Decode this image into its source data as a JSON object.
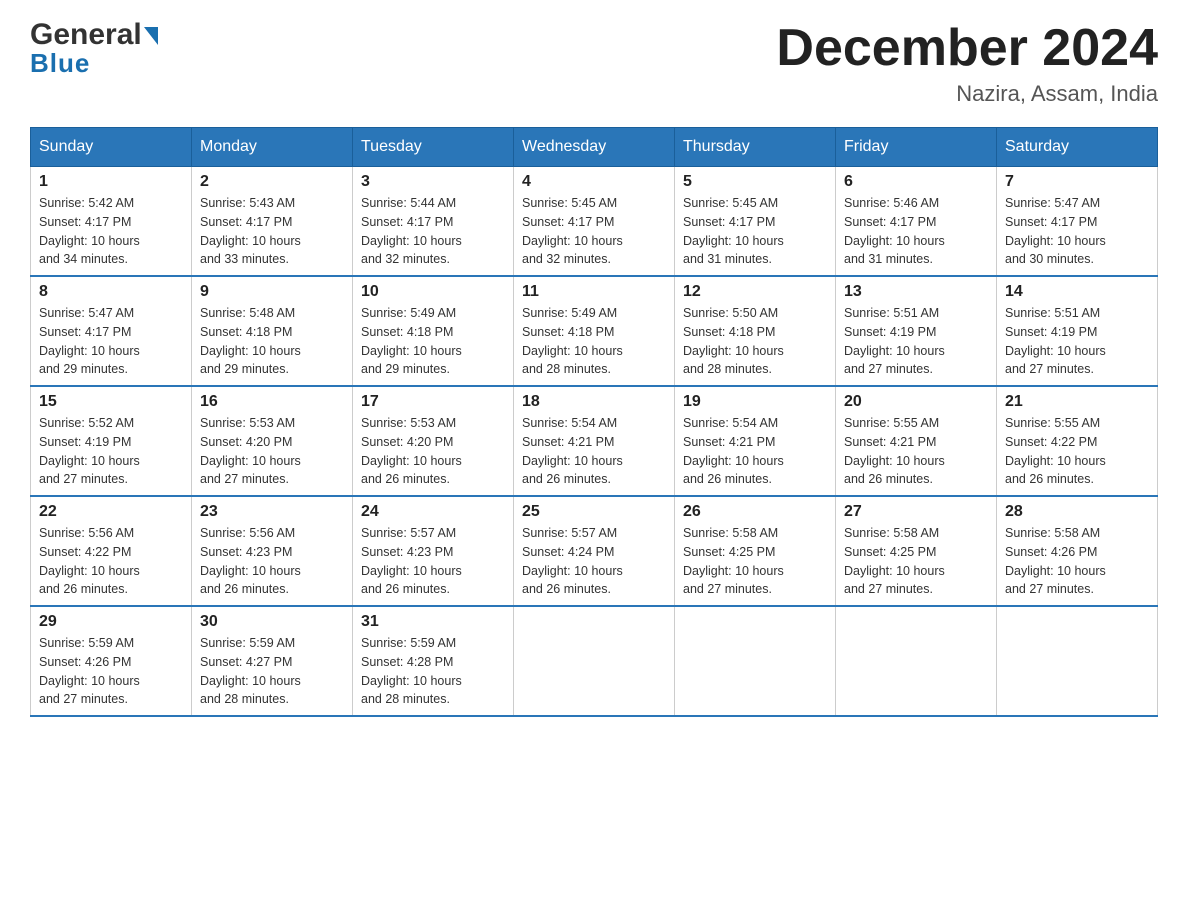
{
  "header": {
    "logo_general": "General",
    "logo_blue": "Blue",
    "title": "December 2024",
    "subtitle": "Nazira, Assam, India"
  },
  "days_of_week": [
    "Sunday",
    "Monday",
    "Tuesday",
    "Wednesday",
    "Thursday",
    "Friday",
    "Saturday"
  ],
  "weeks": [
    [
      {
        "day": "1",
        "sunrise": "5:42 AM",
        "sunset": "4:17 PM",
        "daylight": "10 hours and 34 minutes."
      },
      {
        "day": "2",
        "sunrise": "5:43 AM",
        "sunset": "4:17 PM",
        "daylight": "10 hours and 33 minutes."
      },
      {
        "day": "3",
        "sunrise": "5:44 AM",
        "sunset": "4:17 PM",
        "daylight": "10 hours and 32 minutes."
      },
      {
        "day": "4",
        "sunrise": "5:45 AM",
        "sunset": "4:17 PM",
        "daylight": "10 hours and 32 minutes."
      },
      {
        "day": "5",
        "sunrise": "5:45 AM",
        "sunset": "4:17 PM",
        "daylight": "10 hours and 31 minutes."
      },
      {
        "day": "6",
        "sunrise": "5:46 AM",
        "sunset": "4:17 PM",
        "daylight": "10 hours and 31 minutes."
      },
      {
        "day": "7",
        "sunrise": "5:47 AM",
        "sunset": "4:17 PM",
        "daylight": "10 hours and 30 minutes."
      }
    ],
    [
      {
        "day": "8",
        "sunrise": "5:47 AM",
        "sunset": "4:17 PM",
        "daylight": "10 hours and 29 minutes."
      },
      {
        "day": "9",
        "sunrise": "5:48 AM",
        "sunset": "4:18 PM",
        "daylight": "10 hours and 29 minutes."
      },
      {
        "day": "10",
        "sunrise": "5:49 AM",
        "sunset": "4:18 PM",
        "daylight": "10 hours and 29 minutes."
      },
      {
        "day": "11",
        "sunrise": "5:49 AM",
        "sunset": "4:18 PM",
        "daylight": "10 hours and 28 minutes."
      },
      {
        "day": "12",
        "sunrise": "5:50 AM",
        "sunset": "4:18 PM",
        "daylight": "10 hours and 28 minutes."
      },
      {
        "day": "13",
        "sunrise": "5:51 AM",
        "sunset": "4:19 PM",
        "daylight": "10 hours and 27 minutes."
      },
      {
        "day": "14",
        "sunrise": "5:51 AM",
        "sunset": "4:19 PM",
        "daylight": "10 hours and 27 minutes."
      }
    ],
    [
      {
        "day": "15",
        "sunrise": "5:52 AM",
        "sunset": "4:19 PM",
        "daylight": "10 hours and 27 minutes."
      },
      {
        "day": "16",
        "sunrise": "5:53 AM",
        "sunset": "4:20 PM",
        "daylight": "10 hours and 27 minutes."
      },
      {
        "day": "17",
        "sunrise": "5:53 AM",
        "sunset": "4:20 PM",
        "daylight": "10 hours and 26 minutes."
      },
      {
        "day": "18",
        "sunrise": "5:54 AM",
        "sunset": "4:21 PM",
        "daylight": "10 hours and 26 minutes."
      },
      {
        "day": "19",
        "sunrise": "5:54 AM",
        "sunset": "4:21 PM",
        "daylight": "10 hours and 26 minutes."
      },
      {
        "day": "20",
        "sunrise": "5:55 AM",
        "sunset": "4:21 PM",
        "daylight": "10 hours and 26 minutes."
      },
      {
        "day": "21",
        "sunrise": "5:55 AM",
        "sunset": "4:22 PM",
        "daylight": "10 hours and 26 minutes."
      }
    ],
    [
      {
        "day": "22",
        "sunrise": "5:56 AM",
        "sunset": "4:22 PM",
        "daylight": "10 hours and 26 minutes."
      },
      {
        "day": "23",
        "sunrise": "5:56 AM",
        "sunset": "4:23 PM",
        "daylight": "10 hours and 26 minutes."
      },
      {
        "day": "24",
        "sunrise": "5:57 AM",
        "sunset": "4:23 PM",
        "daylight": "10 hours and 26 minutes."
      },
      {
        "day": "25",
        "sunrise": "5:57 AM",
        "sunset": "4:24 PM",
        "daylight": "10 hours and 26 minutes."
      },
      {
        "day": "26",
        "sunrise": "5:58 AM",
        "sunset": "4:25 PM",
        "daylight": "10 hours and 27 minutes."
      },
      {
        "day": "27",
        "sunrise": "5:58 AM",
        "sunset": "4:25 PM",
        "daylight": "10 hours and 27 minutes."
      },
      {
        "day": "28",
        "sunrise": "5:58 AM",
        "sunset": "4:26 PM",
        "daylight": "10 hours and 27 minutes."
      }
    ],
    [
      {
        "day": "29",
        "sunrise": "5:59 AM",
        "sunset": "4:26 PM",
        "daylight": "10 hours and 27 minutes."
      },
      {
        "day": "30",
        "sunrise": "5:59 AM",
        "sunset": "4:27 PM",
        "daylight": "10 hours and 28 minutes."
      },
      {
        "day": "31",
        "sunrise": "5:59 AM",
        "sunset": "4:28 PM",
        "daylight": "10 hours and 28 minutes."
      },
      null,
      null,
      null,
      null
    ]
  ],
  "labels": {
    "sunrise": "Sunrise:",
    "sunset": "Sunset:",
    "daylight": "Daylight:"
  }
}
